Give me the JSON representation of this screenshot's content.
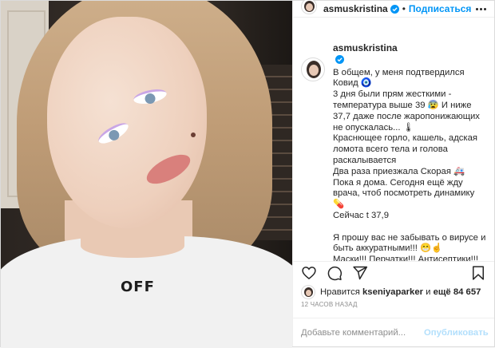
{
  "post": {
    "username": "asmuskristina",
    "follow_label": "Подписаться",
    "separator": "•",
    "image_overlay_text": "OFF"
  },
  "caption": {
    "username": "asmuskristina",
    "paragraph1": "В общем, у меня подтвердился Ковид 🧿\n3 дня были прям жесткими - температура выше 39 😰 И ниже 37,7 даже после жаропонижающих не опускалась... 🌡\nКраснющее горло, кашель, адская ломота всего тела и голова раскалывается\nДва раза приезжала Скорая 🚑\nПока я дома. Сегодня ещё жду врача, чтоб посмотреть динамику 💊\nСейчас t 37,9",
    "paragraph2": "Я прошу вас не забывать о вирусе и быть аккуратными!!! 😁☝\nМаски!!! Перчатки!!! Антисептики!!!\nДистанция!!!"
  },
  "likes": {
    "prefix": "Нравится",
    "user": "kseniyaparker",
    "middle": "и",
    "count_text": "ещё 84 657"
  },
  "timestamp": "12 ЧАСОВ НАЗАД",
  "comment": {
    "placeholder": "Добавьте комментарий...",
    "publish_label": "Опубликовать"
  },
  "colors": {
    "accent": "#0095f6",
    "publish_disabled": "#b2dffc",
    "muted": "#8e8e8e"
  },
  "icons": [
    "verified-icon",
    "more-icon",
    "heart-icon",
    "comment-icon",
    "share-icon",
    "bookmark-icon"
  ]
}
